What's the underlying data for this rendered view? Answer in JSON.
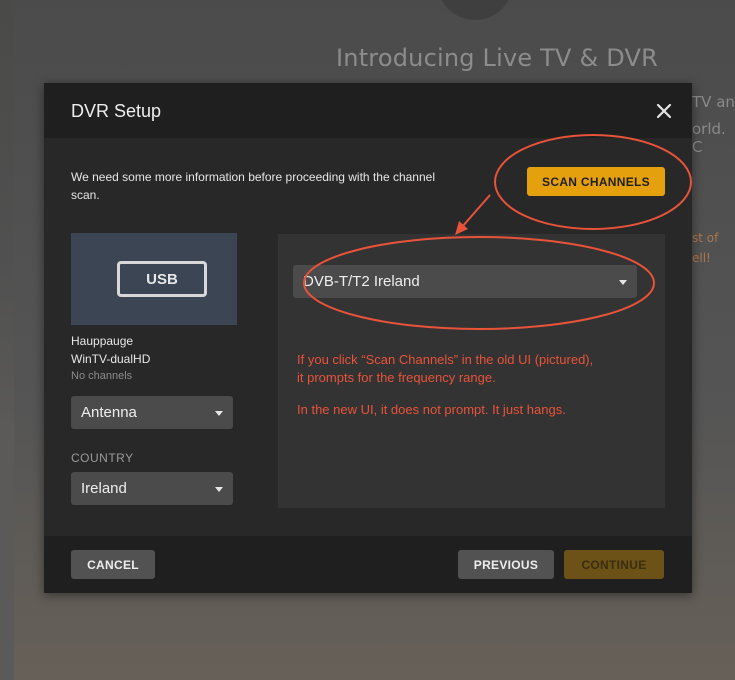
{
  "background": {
    "title": "Introducing Live TV & DVR",
    "line1_fragment": "TV an",
    "line2_fragment": "orld. C",
    "orange1_fragment": "st of",
    "orange2_fragment": "ell!"
  },
  "dialog": {
    "title": "DVR Setup",
    "close_icon": "close-icon",
    "intro_text": "We need some more information before proceeding with the channel scan.",
    "scan_button": "SCAN CHANNELS",
    "device": {
      "badge": "USB",
      "name": "Hauppauge\nWinTV-dualHD",
      "status": "No channels"
    },
    "source_select": {
      "value": "Antenna"
    },
    "country_label": "COUNTRY",
    "country_select": {
      "value": "Ireland"
    },
    "scan_type_select": {
      "value": "DVB-T/T2 Ireland"
    },
    "buttons": {
      "cancel": "CANCEL",
      "previous": "PREVIOUS",
      "continue": "CONTINUE"
    }
  },
  "annotation": {
    "note1": "If you click “Scan Channels” in the old UI (pictured), it prompts for the frequency range.",
    "note2": "In the new UI, it does not prompt. It just hangs.",
    "color": "#e8533a"
  },
  "colors": {
    "accent": "#e5a00d",
    "accent_disabled": "#6d5218",
    "dialog_bg": "#282828",
    "header_bg": "#1f1f1f",
    "field_bg": "#4b4b4b",
    "device_tile": "#3b4553"
  }
}
